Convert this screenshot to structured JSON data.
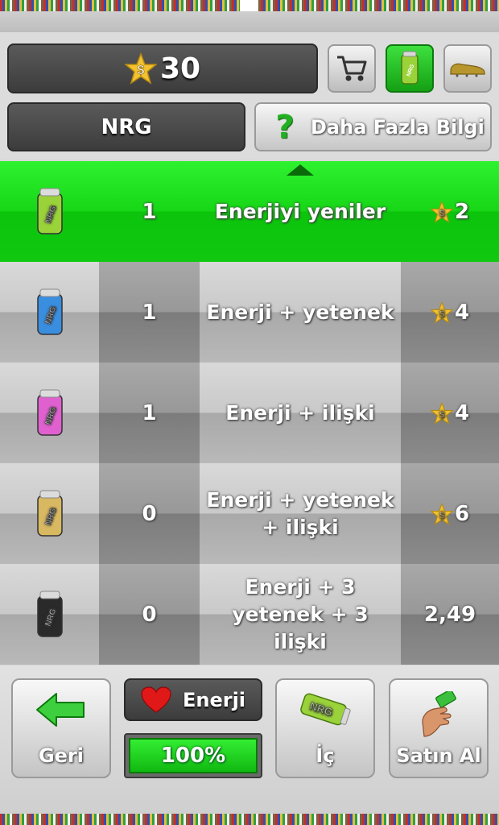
{
  "header": {
    "coins": "30",
    "product_name": "NRG",
    "info_button": "Daha Fazla Bilgi",
    "shop_icon": "shopping-cart-icon",
    "drink_icon": "energy-drink-can-icon",
    "boot_icon": "football-boot-icon"
  },
  "drinks": [
    {
      "can_color": "#9ad23a",
      "quantity": "1",
      "description": "Enerjiyi yeniler",
      "price": "2",
      "price_is_stars": true
    },
    {
      "can_color": "#3a8ee0",
      "quantity": "1",
      "description": "Enerji + yetenek",
      "price": "4",
      "price_is_stars": true
    },
    {
      "can_color": "#e060d0",
      "quantity": "1",
      "description": "Enerji + ilişki",
      "price": "4",
      "price_is_stars": true
    },
    {
      "can_color": "#d8b860",
      "quantity": "0",
      "description": "Enerji + yetenek + ilişki",
      "price": "6",
      "price_is_stars": true
    },
    {
      "can_color": "#2a2a2a",
      "quantity": "0",
      "description": "Enerji + 3 yetenek + 3 ilişki",
      "price": "2,49",
      "price_is_stars": false
    }
  ],
  "footer": {
    "back_label": "Geri",
    "energy_label": "Enerji",
    "energy_percent_text": "100%",
    "energy_level": 1.0,
    "drink_label": "İç",
    "buy_label": "Satın Al"
  },
  "colors": {
    "accent_green": "#16d616",
    "dark_panel": "#4a4a4a"
  }
}
